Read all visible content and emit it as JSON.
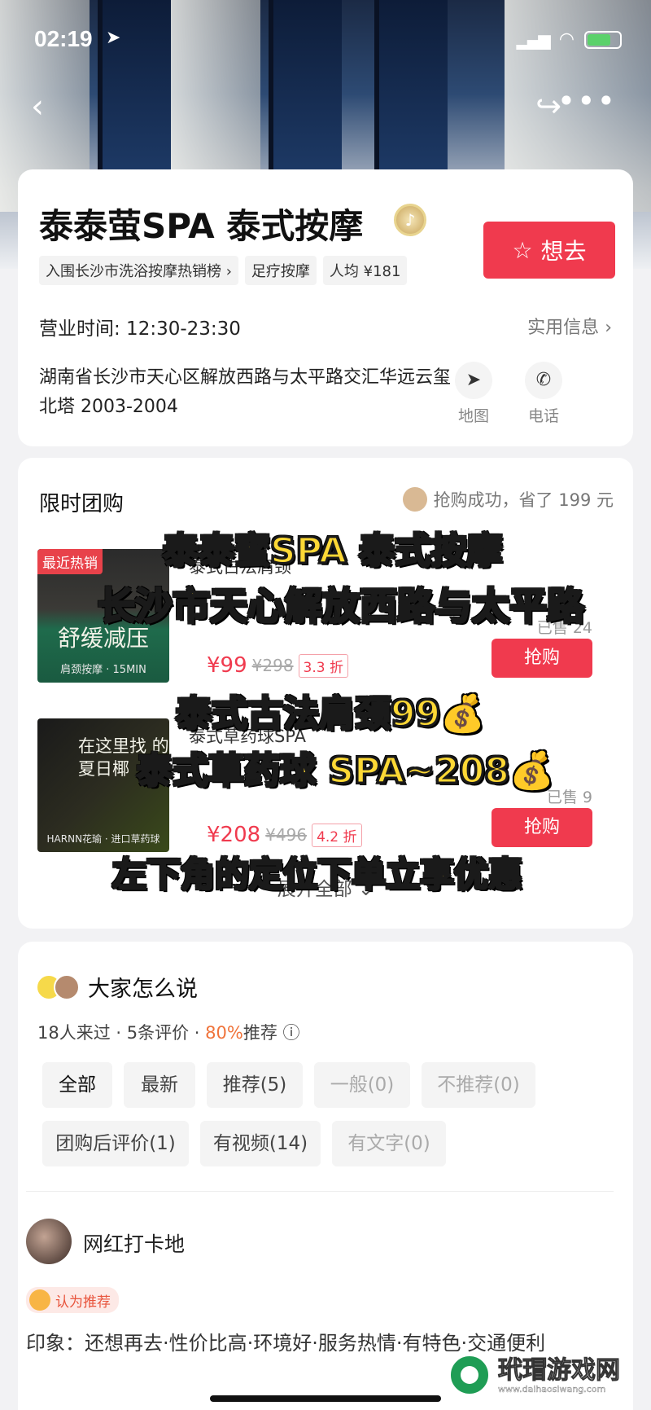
{
  "status": {
    "time": "02:19"
  },
  "shop": {
    "name": "泰泰萤SPA 泰式按摩",
    "tags": [
      "入围长沙市洗浴按摩热销榜 ›",
      "足疗按摩",
      "人均 ¥181"
    ],
    "want_label": "想去",
    "hours": "营业时间: 12:30-23:30",
    "info_link": "实用信息",
    "address": "湖南省长沙市天心区解放西路与太平路交汇华远云玺北塔 2003-2004",
    "map_label": "地图",
    "phone_label": "电话"
  },
  "deals": {
    "title": "限时团购",
    "tip": "抢购成功，省了 199 元",
    "items": [
      {
        "img_label": "最近热销",
        "img_caption": "舒缓减压",
        "img_sub": "肩颈按摩 · 15MIN",
        "name": "泰式古法肩颈",
        "sold": "已售 24",
        "price": "¥99",
        "old_price": "¥298",
        "discount": "3.3 折",
        "button": "抢购"
      },
      {
        "img_label": "",
        "img_caption": "在这里找 的夏日椰",
        "img_sub": "HARNN花瑜 · 进口草药球",
        "name": "泰式草药球SPA",
        "sold": "已售 9",
        "price": "¥208",
        "old_price": "¥496",
        "discount": "4.2 折",
        "button": "抢购"
      }
    ],
    "expand": "展开全部 ⌄"
  },
  "overlay": {
    "line1": "泰泰蜜SPA 泰式按摩",
    "line2": "长沙市天心解放西路与太平路",
    "line3": "泰式古法肩颈99💰",
    "line4": "泰式草药球 SPA~208💰",
    "line5": "左下角的定位下单立享优惠"
  },
  "reviews": {
    "title": "大家怎么说",
    "stats_prefix": "18人来过 · 5条评价 · ",
    "percent": "80%",
    "stats_suffix": "推荐 ⓘ",
    "filters": [
      "全部",
      "最新",
      "推荐(5)",
      "一般(0)",
      "不推荐(0)",
      "团购后评价(1)",
      "有视频(14)",
      "有文字(0)"
    ],
    "user": "网红打卡地",
    "badge": "认为推荐",
    "impression": "印象：还想再去·性价比高·环境好·服务热情·有特色·交通便利"
  },
  "watermark": {
    "text": "玳瑁游戏网",
    "url": "www.daihaosiwang.com"
  }
}
